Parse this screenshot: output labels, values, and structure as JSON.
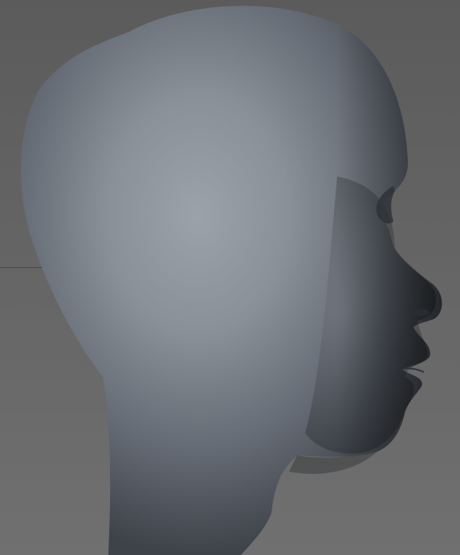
{
  "viewport": {
    "background_color": "#6a6a6a",
    "gradient_top_color": "#5c5c5c",
    "gradient_bottom_color": "#707070"
  },
  "axis_line": {
    "color": "#3c3f9a"
  },
  "model": {
    "surface_light_color": "#9aa0a8",
    "surface_mid_color": "#737a83",
    "surface_dark_color": "#3d4249",
    "shadow_color": "#1d1f23"
  }
}
